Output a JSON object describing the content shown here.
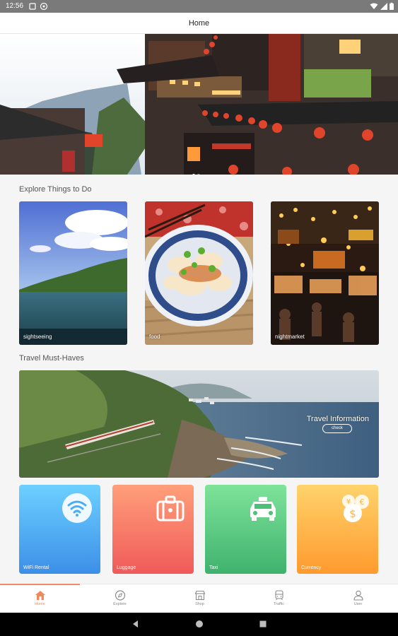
{
  "status_bar": {
    "time": "12:56"
  },
  "app_bar": {
    "title": "Home"
  },
  "hero": {
    "slides": 2,
    "active_slide": 1
  },
  "explore": {
    "title": "Explore Things to Do",
    "cards": [
      {
        "label": "sightseeing"
      },
      {
        "label": "food"
      },
      {
        "label": "nightmarket"
      }
    ]
  },
  "must_haves": {
    "title": "Travel Must-Haves",
    "banner": {
      "title": "Travel Information",
      "button": "check"
    },
    "tiles": [
      {
        "label": "WiFi Rental",
        "icon": "wifi-icon",
        "color_top": "#6cd0ff",
        "color_bottom": "#3c8fe8"
      },
      {
        "label": "Luggage",
        "icon": "luggage-icon",
        "color_top": "#ff9f7a",
        "color_bottom": "#f05a5a"
      },
      {
        "label": "Taxi",
        "icon": "taxi-icon",
        "color_top": "#7fe39a",
        "color_bottom": "#3fb26e"
      },
      {
        "label": "Currency",
        "icon": "currency-icon",
        "color_top": "#ffd36b",
        "color_bottom": "#ff9a2e"
      }
    ]
  },
  "tabs": [
    {
      "label": "Home",
      "icon": "home-icon",
      "active": true
    },
    {
      "label": "Explore",
      "icon": "compass-icon",
      "active": false
    },
    {
      "label": "Shop",
      "icon": "shop-icon",
      "active": false
    },
    {
      "label": "Traffic",
      "icon": "train-icon",
      "active": false
    },
    {
      "label": "User",
      "icon": "user-icon",
      "active": false
    }
  ],
  "colors": {
    "accent": "#f08a5d"
  }
}
